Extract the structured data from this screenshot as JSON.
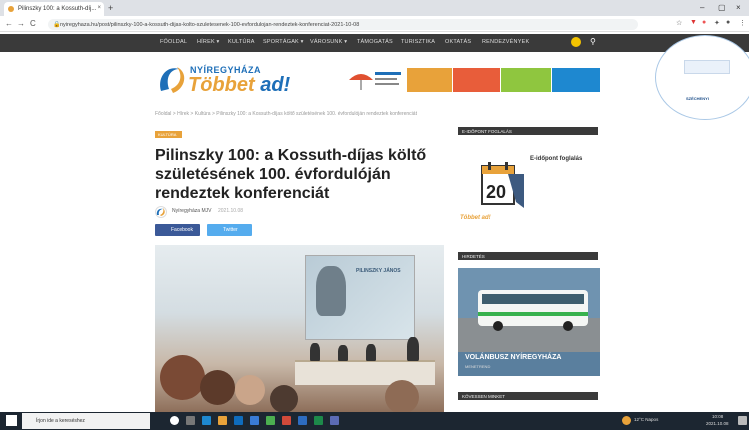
{
  "browser": {
    "tab_title": "Pilinszky 100: a Kossuth-díj...",
    "tab_close": "×",
    "new_tab": "+",
    "url": "nyiregyhaza.hu/post/pilinszky-100-a-kossuth-dijas-kolto-szuletesenek-100-evfordulojan-rendeztek-konferenciat-2021-10-08",
    "back": "←",
    "forward": "→",
    "reload": "C",
    "home": "⌂",
    "minimize": "–",
    "maximize": "▢",
    "close": "×",
    "star": "☆",
    "menu": "⋮"
  },
  "site_nav": {
    "items": [
      "FŐOLDAL",
      "HÍREK ▾",
      "KULTÚRA",
      "SPORTÁGAK ▾",
      "VÁROSUNK ▾",
      "TÁMOGATÁS",
      "TURISZTIKA",
      "OKTATÁS",
      "RENDEZVÉNYEK"
    ],
    "search_icon": "search-icon"
  },
  "logo": {
    "top": "NYÍREGYHÁZA",
    "main_a": "Többet",
    "main_b": " ad!"
  },
  "article": {
    "breadcrumb": "Főoldal > Hírek > Kultúra > Pilinszky 100: a Kossuth-díjas költő születésének 100. évfordulóján rendeztek konferenciát",
    "category": "KULTÚRA",
    "title": "Pilinszky 100: a Kossuth-díjas költő születésének 100. évfordulóján rendeztek konferenciát",
    "author": "Nyíregyháza MJV",
    "date": "2021.10.08",
    "share_fb": "Facebook",
    "share_tw": "Twitter",
    "screen_text": "PILINSZKY JÁNOS"
  },
  "sidebar": {
    "head1": "E-IDŐPONT FOGLALÁS",
    "cal_label": "E-időpont foglalás",
    "cal_number": "20",
    "cal_logo": "Többet ad!",
    "head2": "HIRDETÉS",
    "bus_title": "VOLÁNBUSZ NYÍREGYHÁZA",
    "bus_sub": "MENETREND",
    "head3": "KÖVESSEN MINKET"
  },
  "right_ad": {
    "label": "SZÉCHENYI"
  },
  "taskbar": {
    "search_placeholder": "Írjon ide a kereséshez",
    "tray": "12°C Napos",
    "time": "10:08",
    "date": "2021.10.08"
  },
  "colors": {
    "accent": "#e8a23a",
    "brand": "#1e6fb8",
    "nav_bg": "#3a3a3a"
  }
}
